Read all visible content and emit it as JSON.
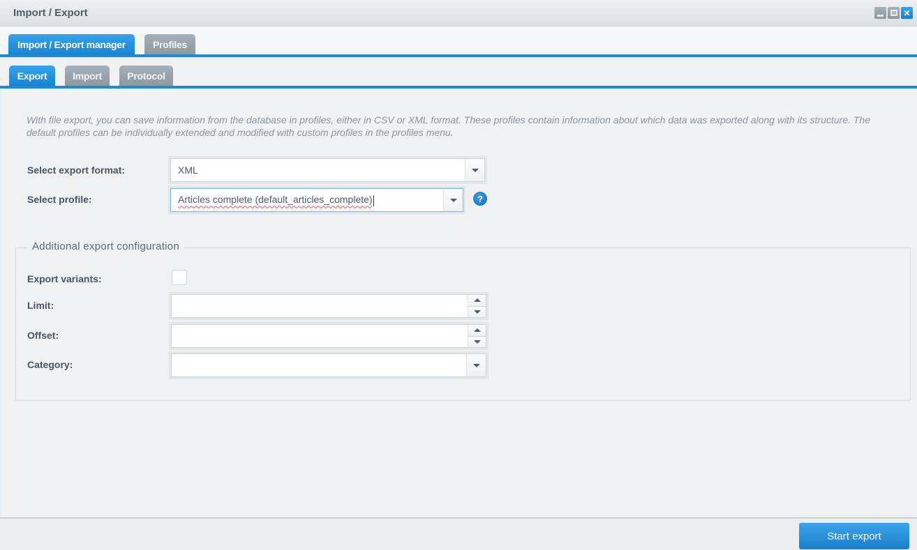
{
  "window": {
    "title": "Import / Export",
    "controls": {
      "minimize": "minimize",
      "maximize": "maximize",
      "close": "✕"
    }
  },
  "tabs": [
    {
      "label": "Import / Export manager",
      "active": true
    },
    {
      "label": "Profiles",
      "active": false
    }
  ],
  "subtabs": [
    {
      "label": "Export",
      "active": true
    },
    {
      "label": "Import",
      "active": false
    },
    {
      "label": "Protocol",
      "active": false
    }
  ],
  "export": {
    "intro": "With file export, you can save information from the database in profiles, either in CSV or XML format. These profiles contain information about which data was exported along with its structure. The default profiles can be individually extended and modified with custom profiles in the profiles menu.",
    "format": {
      "label": "Select export format:",
      "value": "XML"
    },
    "profile": {
      "label": "Select profile:",
      "value": "Articles complete (default_articles_complete)",
      "help": "?"
    },
    "additional": {
      "legend": "Additional export configuration",
      "variants": {
        "label": "Export variants:",
        "checked": false
      },
      "limit": {
        "label": "Limit:",
        "value": ""
      },
      "offset": {
        "label": "Offset:",
        "value": ""
      },
      "category": {
        "label": "Category:",
        "value": ""
      }
    }
  },
  "footer": {
    "start_label": "Start export"
  },
  "colors": {
    "accent": "#1d8ad6",
    "tab_inactive": "#98a3ab",
    "background": "#eff1f3"
  }
}
